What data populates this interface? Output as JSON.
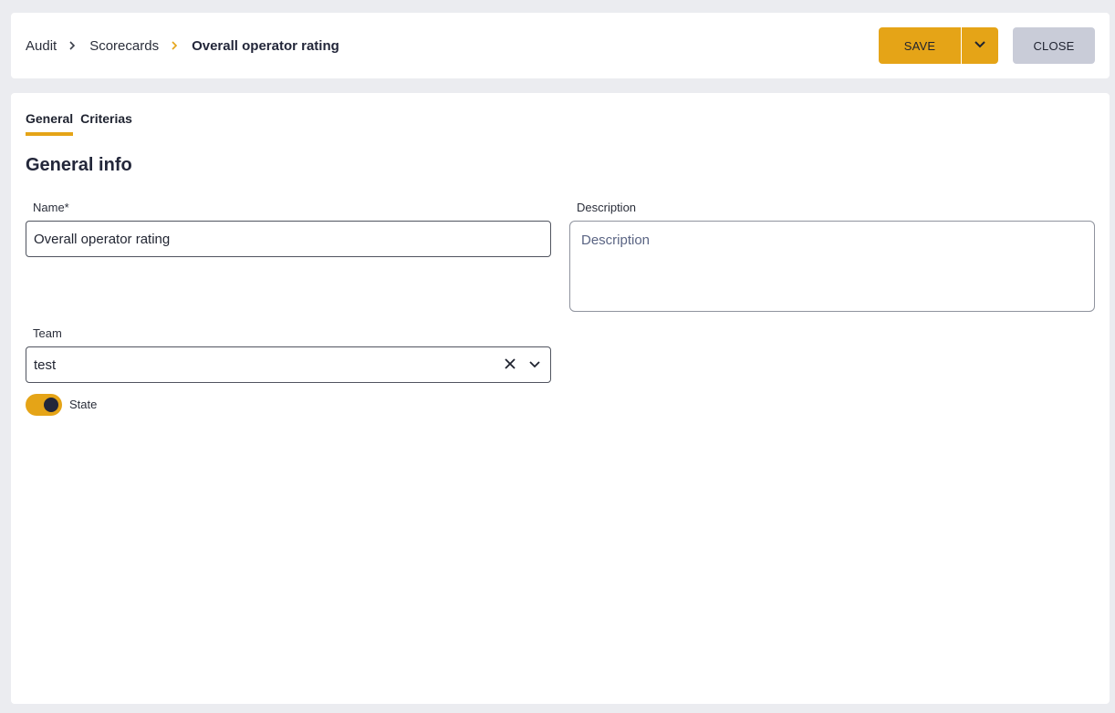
{
  "breadcrumb": {
    "items": [
      "Audit",
      "Scorecards",
      "Overall operator rating"
    ]
  },
  "toolbar": {
    "save_label": "SAVE",
    "close_label": "CLOSE"
  },
  "tabs": [
    {
      "label": "General",
      "active": true
    },
    {
      "label": "Criterias",
      "active": false
    }
  ],
  "section_title": "General info",
  "form": {
    "name": {
      "label": "Name*",
      "value": "Overall operator rating"
    },
    "description": {
      "label": "Description",
      "value": "",
      "placeholder": "Description"
    },
    "team": {
      "label": "Team",
      "value": "test"
    },
    "state": {
      "label": "State",
      "enabled": true
    }
  },
  "icons": {
    "breadcrumb_separator": "chevron-right-icon",
    "save_menu": "chevron-down-icon",
    "clear": "close-icon",
    "dropdown": "chevron-down-icon"
  },
  "colors": {
    "accent": "#e5a417",
    "close_button": "#c9ccd8",
    "background": "#ebecf0"
  }
}
